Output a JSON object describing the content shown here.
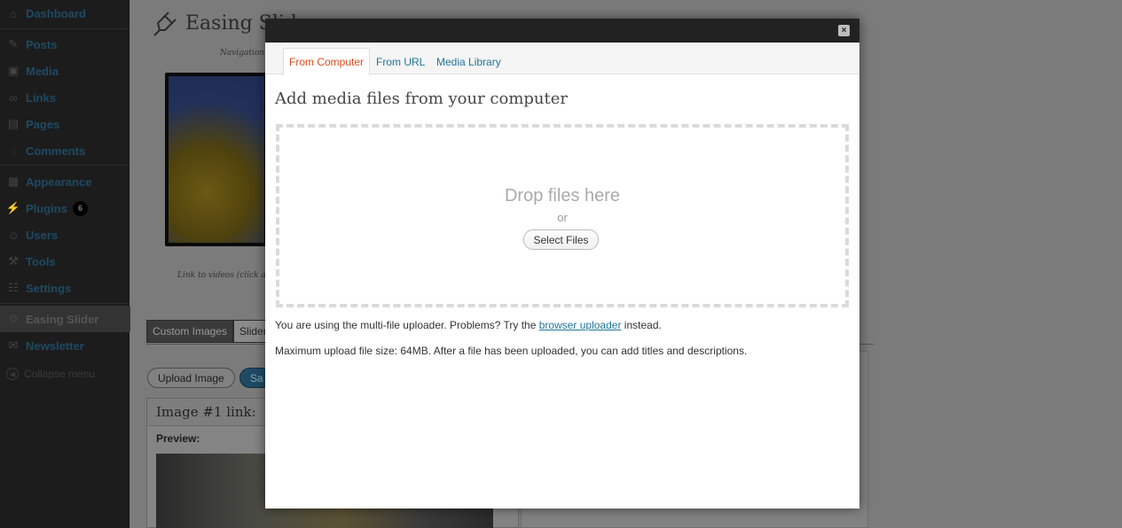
{
  "sidebar": {
    "items": [
      {
        "label": "Dashboard",
        "icon": "dashboard-icon"
      },
      {
        "label": "Posts",
        "icon": "pushpin-icon"
      },
      {
        "label": "Media",
        "icon": "media-icon"
      },
      {
        "label": "Links",
        "icon": "link-icon"
      },
      {
        "label": "Pages",
        "icon": "page-icon"
      },
      {
        "label": "Comments",
        "icon": "comment-icon"
      },
      {
        "label": "Appearance",
        "icon": "appearance-icon"
      },
      {
        "label": "Plugins",
        "icon": "plugin-icon",
        "badge": "6"
      },
      {
        "label": "Users",
        "icon": "users-icon"
      },
      {
        "label": "Tools",
        "icon": "tools-icon"
      },
      {
        "label": "Settings",
        "icon": "settings-icon"
      },
      {
        "label": "Easing Slider",
        "icon": "slider-icon",
        "current": true
      },
      {
        "label": "Newsletter",
        "icon": "newsletter-icon"
      }
    ],
    "collapse_label": "Collapse menu"
  },
  "page": {
    "title": "Easing Slider",
    "tagline": "Navigation p",
    "preview_caption": "Link to videos (click a",
    "tabs": [
      "Custom Images",
      "Slider"
    ],
    "upload_image_label": "Upload Image",
    "save_label": "Sa",
    "image_box_title": "Image #1 link:",
    "preview_label": "Preview:"
  },
  "modal": {
    "close_label": "×",
    "tabs": [
      {
        "label": "From Computer",
        "active": true
      },
      {
        "label": "From URL",
        "active": false
      },
      {
        "label": "Media Library",
        "active": false
      }
    ],
    "heading": "Add media files from your computer",
    "drop_text": "Drop files here",
    "or_text": "or",
    "select_files_label": "Select Files",
    "uploader_note_prefix": "You are using the multi-file uploader. Problems? Try the",
    "uploader_note_link": "browser uploader",
    "uploader_note_suffix": "instead.",
    "max_size_note": "Maximum upload file size: 64MB. After a file has been uploaded, you can add titles and descriptions."
  },
  "colors": {
    "link": "#21759b",
    "active_tab": "#d54e21",
    "overlay": "#7a7a7a",
    "sidebar_bg": "#1c1c1c",
    "titlebar": "#222222"
  }
}
